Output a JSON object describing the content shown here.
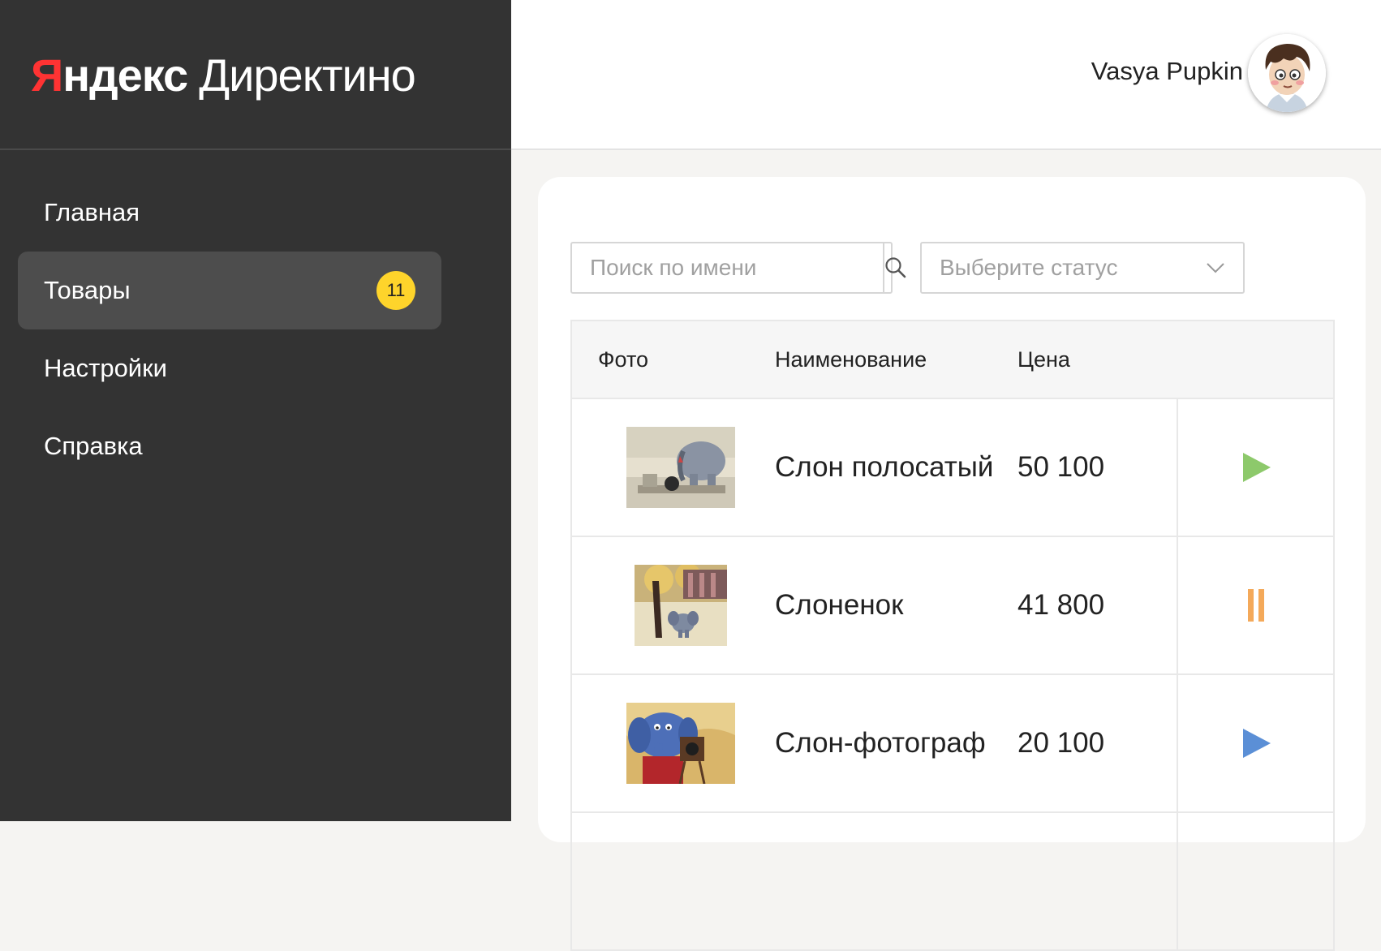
{
  "logo": {
    "ya": "Я",
    "ndeks": "ндекс",
    "product": "Директино"
  },
  "nav": [
    {
      "label": "Главная",
      "active": false
    },
    {
      "label": "Товары",
      "active": true,
      "badge": "11"
    },
    {
      "label": "Настройки",
      "active": false
    },
    {
      "label": "Справка",
      "active": false
    }
  ],
  "header": {
    "user_name": "Vasya Pupkin"
  },
  "filters": {
    "search_placeholder": "Поиск по имени",
    "status_placeholder": "Выберите статус"
  },
  "table": {
    "columns": [
      "Фото",
      "Наименование",
      "Цена"
    ],
    "rows": [
      {
        "name": "Слон полосатый",
        "price": "50 100",
        "action": "play-icon",
        "action_color": "#8dc96b"
      },
      {
        "name": "Слоненок",
        "price": "41 800",
        "action": "pause-icon",
        "action_color": "#f4a95a"
      },
      {
        "name": "Слон-фотограф",
        "price": "20 100",
        "action": "play-icon",
        "action_color": "#5b8fd6"
      }
    ]
  },
  "colors": {
    "sidebar_bg": "#333333",
    "active_nav_bg": "#4d4d4d",
    "badge_bg": "#fed42b",
    "logo_accent": "#ff3333"
  }
}
